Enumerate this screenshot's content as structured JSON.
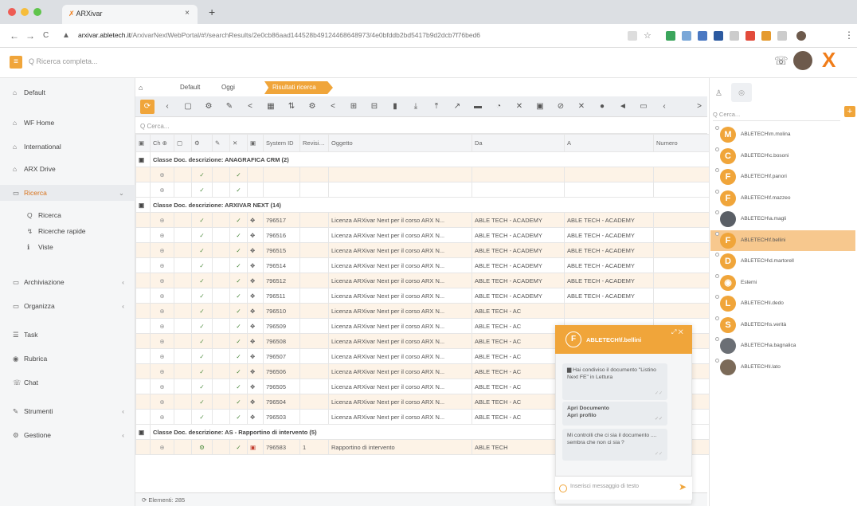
{
  "browser": {
    "tab_title": "ARXivar",
    "tab_close": "×",
    "new_tab": "+",
    "url_host": "arxivar.abletech.it",
    "url_path": "/ArxivarNextWebPortal/#!/searchResults/2e0cb86aad144528b49124468648973/4e0bfddb2bd5417b9d2dcb7f76bed6",
    "back": "←",
    "forward": "→",
    "reload": "C"
  },
  "header": {
    "menu_icon": "≡",
    "search_placeholder": "Q  Ricerca completa...",
    "chat_icon": "☏",
    "logo": "X"
  },
  "sidebar": {
    "items": [
      {
        "icon": "⌂",
        "label": "Default"
      },
      {
        "icon": "⌂",
        "label": "WF Home"
      },
      {
        "icon": "⌂",
        "label": "International"
      },
      {
        "icon": "⌂",
        "label": "ARX Drive"
      },
      {
        "icon": "▭",
        "label": "Ricerca",
        "arrow": "⌄"
      },
      {
        "icon": "Q",
        "label": "Ricerca"
      },
      {
        "icon": "↯",
        "label": "Ricerche rapide"
      },
      {
        "icon": "ℹ",
        "label": "Viste"
      },
      {
        "icon": "▭",
        "label": "Archiviazione",
        "arrow": "‹"
      },
      {
        "icon": "▭",
        "label": "Organizza",
        "arrow": "‹"
      },
      {
        "icon": "☰",
        "label": "Task"
      },
      {
        "icon": "◉",
        "label": "Rubrica"
      },
      {
        "icon": "☏",
        "label": "Chat"
      },
      {
        "icon": "✎",
        "label": "Strumenti",
        "arrow": "‹"
      },
      {
        "icon": "⚙",
        "label": "Gestione",
        "arrow": "‹"
      }
    ]
  },
  "breadcrumb": {
    "home_icon": "⌂",
    "items": [
      "Default",
      "Oggi",
      "Risultati ricerca"
    ]
  },
  "toolbar": {
    "refresh_icon": "⟳",
    "icons": [
      "‹",
      "▢",
      "⚙",
      "✎",
      "<",
      "▦",
      "⇅",
      "⚙",
      "<",
      "⊞",
      "⊟",
      "▮",
      "⤓",
      "⤒",
      "↗",
      "▬",
      "◔",
      "✕",
      "▣",
      "⊘",
      "✕",
      "●",
      "◄",
      "▭",
      "‹"
    ],
    "more": ">"
  },
  "grid": {
    "search_placeholder": "Q  Cerca...",
    "columns": [
      "▣",
      "Ch ⊕",
      "▢",
      "⚙",
      "✎",
      "✕",
      "▣",
      "System ID",
      "Revisione",
      "Oggetto",
      "Da",
      "A",
      "Numero"
    ],
    "groups": [
      {
        "label": "Classe Doc. descrizione: ANAGRAFICA CRM (2)",
        "rows": [
          {
            "c1": "⊕",
            "c2": "✓",
            "c3": "✓",
            "sid": "",
            "rev": "",
            "obj": "",
            "da": "",
            "a": ""
          },
          {
            "c1": "⊕",
            "c2": "✓",
            "c3": "✓",
            "sid": "",
            "rev": "",
            "obj": "",
            "da": "",
            "a": ""
          }
        ]
      },
      {
        "label": "Classe Doc. descrizione: ARXIVAR NEXT (14)",
        "rows": [
          {
            "c1": "⊕",
            "c2": "✓",
            "c3": "✓",
            "c4": "✥",
            "sid": "796517",
            "rev": "",
            "obj": "Licenza ARXivar Next per il corso ARX N...",
            "da": "ABLE TECH - ACADEMY",
            "a": "ABLE TECH - ACADEMY"
          },
          {
            "c1": "⊕",
            "c2": "✓",
            "c3": "✓",
            "c4": "✥",
            "sid": "796516",
            "rev": "",
            "obj": "Licenza ARXivar Next per il corso ARX N...",
            "da": "ABLE TECH - ACADEMY",
            "a": "ABLE TECH - ACADEMY"
          },
          {
            "c1": "⊕",
            "c2": "✓",
            "c3": "✓",
            "c4": "✥",
            "sid": "796515",
            "rev": "",
            "obj": "Licenza ARXivar Next per il corso ARX N...",
            "da": "ABLE TECH - ACADEMY",
            "a": "ABLE TECH - ACADEMY"
          },
          {
            "c1": "⊕",
            "c2": "✓",
            "c3": "✓",
            "c4": "✥",
            "sid": "796514",
            "rev": "",
            "obj": "Licenza ARXivar Next per il corso ARX N...",
            "da": "ABLE TECH - ACADEMY",
            "a": "ABLE TECH - ACADEMY"
          },
          {
            "c1": "⊕",
            "c2": "✓",
            "c3": "✓",
            "c4": "✥",
            "sid": "796512",
            "rev": "",
            "obj": "Licenza ARXivar Next per il corso ARX N...",
            "da": "ABLE TECH - ACADEMY",
            "a": "ABLE TECH - ACADEMY"
          },
          {
            "c1": "⊕",
            "c2": "✓",
            "c3": "✓",
            "c4": "✥",
            "sid": "796511",
            "rev": "",
            "obj": "Licenza ARXivar Next per il corso ARX N...",
            "da": "ABLE TECH - ACADEMY",
            "a": "ABLE TECH - ACADEMY"
          },
          {
            "c1": "⊕",
            "c2": "✓",
            "c3": "✓",
            "c4": "✥",
            "sid": "796510",
            "rev": "",
            "obj": "Licenza ARXivar Next per il corso ARX N...",
            "da": "ABLE TECH - AC",
            "a": ""
          },
          {
            "c1": "⊕",
            "c2": "✓",
            "c3": "✓",
            "c4": "✥",
            "sid": "796509",
            "rev": "",
            "obj": "Licenza ARXivar Next per il corso ARX N...",
            "da": "ABLE TECH - AC",
            "a": ""
          },
          {
            "c1": "⊕",
            "c2": "✓",
            "c3": "✓",
            "c4": "✥",
            "sid": "796508",
            "rev": "",
            "obj": "Licenza ARXivar Next per il corso ARX N...",
            "da": "ABLE TECH - AC",
            "a": ""
          },
          {
            "c1": "⊕",
            "c2": "✓",
            "c3": "✓",
            "c4": "✥",
            "sid": "796507",
            "rev": "",
            "obj": "Licenza ARXivar Next per il corso ARX N...",
            "da": "ABLE TECH - AC",
            "a": ""
          },
          {
            "c1": "⊕",
            "c2": "✓",
            "c3": "✓",
            "c4": "✥",
            "sid": "796506",
            "rev": "",
            "obj": "Licenza ARXivar Next per il corso ARX N...",
            "da": "ABLE TECH - AC",
            "a": ""
          },
          {
            "c1": "⊕",
            "c2": "✓",
            "c3": "✓",
            "c4": "✥",
            "sid": "796505",
            "rev": "",
            "obj": "Licenza ARXivar Next per il corso ARX N...",
            "da": "ABLE TECH - AC",
            "a": ""
          },
          {
            "c1": "⊕",
            "c2": "✓",
            "c3": "✓",
            "c4": "✥",
            "sid": "796504",
            "rev": "",
            "obj": "Licenza ARXivar Next per il corso ARX N...",
            "da": "ABLE TECH - AC",
            "a": ""
          },
          {
            "c1": "⊕",
            "c2": "✓",
            "c3": "✓",
            "c4": "✥",
            "sid": "796503",
            "rev": "",
            "obj": "Licenza ARXivar Next per il corso ARX N...",
            "da": "ABLE TECH - AC",
            "a": ""
          }
        ]
      },
      {
        "label": "Classe Doc. descrizione: AS - Rapportino di intervento (5)",
        "rows": [
          {
            "c1": "⊕",
            "c2": "⚙",
            "c3": "✓",
            "c4": "▣",
            "sid": "796583",
            "rev": "1",
            "obj": "Rapportino di intervento",
            "da": "ABLE TECH",
            "a": ""
          }
        ]
      }
    ],
    "status": "⟳  Elementi: 285"
  },
  "contacts_panel": {
    "tab_user_icon": "♙",
    "tab_gear_icon": "◎",
    "search_placeholder": "Q  Cerca...",
    "add_label": "+",
    "contacts": [
      {
        "initial": "M",
        "name": "ABLETECH\\m.molina",
        "color": "#f0a53a"
      },
      {
        "initial": "C",
        "name": "ABLETECH\\c.bosoni",
        "color": "#f0a53a"
      },
      {
        "initial": "F",
        "name": "ABLETECH\\f.panori",
        "color": "#f0a53a"
      },
      {
        "initial": "F",
        "name": "ABLETECH\\f.mazzeo",
        "color": "#f0a53a"
      },
      {
        "initial": "",
        "name": "ABLETECH\\a.magli",
        "color": "#5a5f66"
      },
      {
        "initial": "F",
        "name": "ABLETECH\\f.bellini",
        "color": "#f0a53a"
      },
      {
        "initial": "D",
        "name": "ABLETECH\\d.martorell",
        "color": "#f0a53a"
      },
      {
        "initial": "◉",
        "name": "Esterni",
        "color": "#f0a53a"
      },
      {
        "initial": "L",
        "name": "ABLETECH\\l.dedo",
        "color": "#f0a53a"
      },
      {
        "initial": "S",
        "name": "ABLETECH\\s.verità",
        "color": "#f0a53a"
      },
      {
        "initial": "",
        "name": "ABLETECH\\a.bagnalica",
        "color": "#6b6f75"
      },
      {
        "initial": "",
        "name": "ABLETECH\\l.lato",
        "color": "#7b6a58"
      }
    ]
  },
  "chat": {
    "avatar_initial": "F",
    "title": "ABLETECH\\f.bellini",
    "controls": "⤢ ✕",
    "messages": [
      {
        "text": "▆ Hai condiviso il documento \"Listino Next FE\" in Lettura",
        "time": ""
      },
      {
        "text": "Apri Documento\nApri profilo",
        "time": ""
      },
      {
        "text": "Mi controlli che ci sia il documento .... sembra che non ci sia ?",
        "time": ""
      }
    ],
    "input_placeholder": "Inserisci messaggio di testo",
    "send_icon": "➤"
  }
}
